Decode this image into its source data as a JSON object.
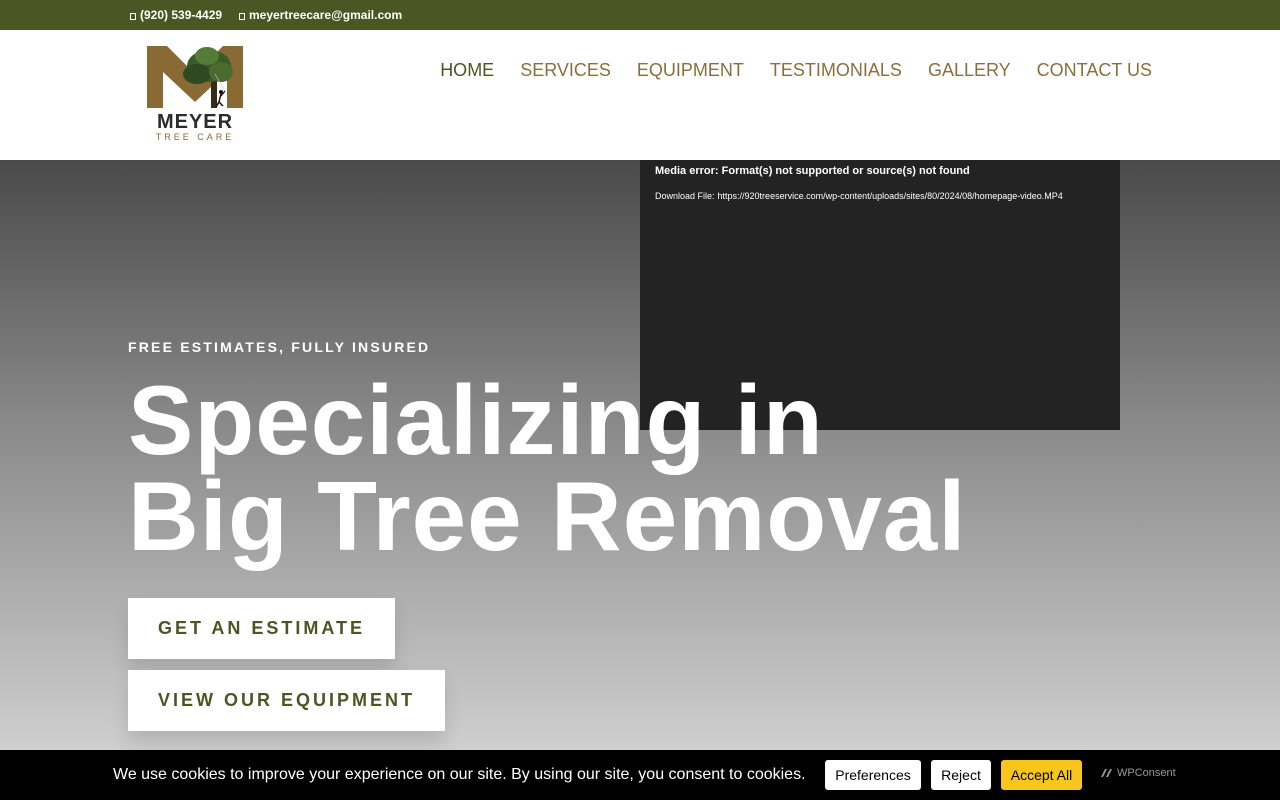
{
  "topbar": {
    "phone": "(920) 539-4429",
    "email": "meyertreecare@gmail.com",
    "phone_icon": "phone-icon",
    "email_icon": "envelope-icon"
  },
  "logo": {
    "name": "MEYER",
    "subtitle": "TREE CARE"
  },
  "nav": {
    "items": [
      {
        "label": "HOME"
      },
      {
        "label": "SERVICES"
      },
      {
        "label": "EQUIPMENT"
      },
      {
        "label": "TESTIMONIALS"
      },
      {
        "label": "GALLERY"
      },
      {
        "label": "CONTACT US"
      }
    ]
  },
  "video": {
    "error": "Media error: Format(s) not supported or source(s) not found",
    "download_label": "Download File:",
    "download_url": "https://920treeservice.com/wp-content/uploads/sites/80/2024/08/homepage-video.MP4"
  },
  "hero": {
    "eyebrow": "FREE ESTIMATES, FULLY INSURED",
    "headline_line1": "Specializing in",
    "headline_line2": "Big Tree Removal",
    "btn_estimate": "GET AN ESTIMATE",
    "btn_equipment": "VIEW OUR EQUIPMENT"
  },
  "cookie": {
    "message": "We use cookies to improve your experience on our site. By using our site, you consent to cookies.",
    "preferences": "Preferences",
    "reject": "Reject",
    "accept": "Accept All",
    "brand": "WPConsent"
  },
  "colors": {
    "olive": "#4a5623",
    "gold_brown": "#8a6f3c",
    "accept_yellow": "#f8c51c",
    "video_bg": "#232323"
  }
}
